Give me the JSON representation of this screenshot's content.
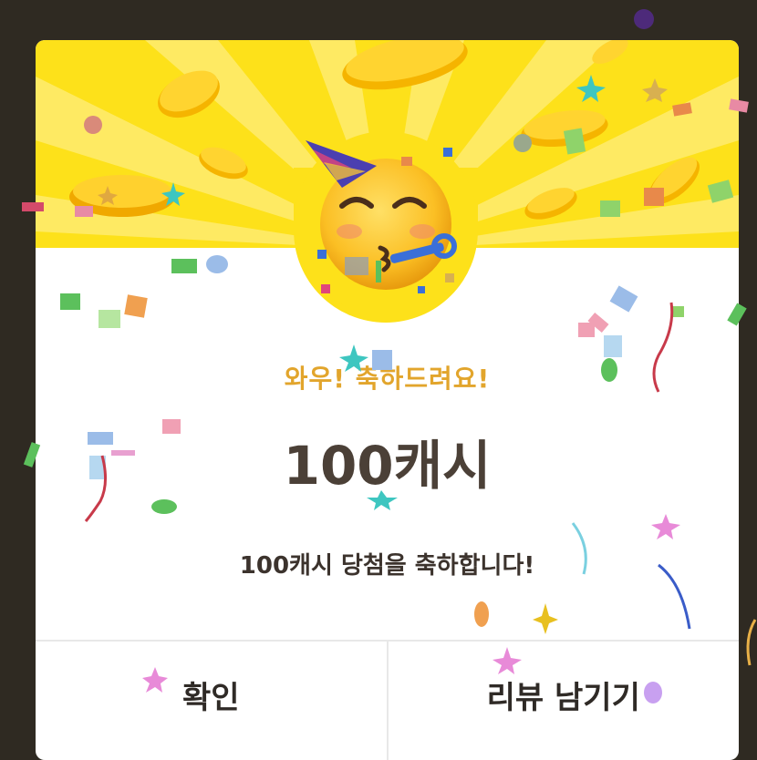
{
  "dialog": {
    "headline": "와우! 축하드려요!",
    "reward_amount": "100캐시",
    "message": "100캐시 당첨을 축하합니다!",
    "confirm_label": "확인",
    "review_label": "리뷰 남기기"
  },
  "colors": {
    "backdrop": "#2f2a22",
    "banner": "#fde11a",
    "headline": "#e2a52c",
    "amount": "#4b4037"
  },
  "icons": [
    "party-face-emoji",
    "gold-coin",
    "confetti"
  ]
}
